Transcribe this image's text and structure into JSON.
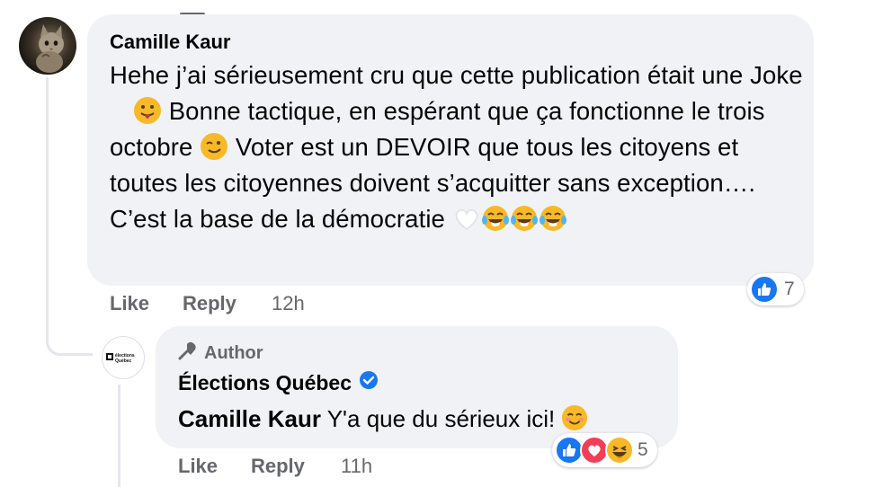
{
  "comment": {
    "author_name": "Camille Kaur",
    "text_parts": [
      "Hehe j’ai sérieusement cru que cette publication était une Joke ",
      " Bonne tactique, en espérant que ça fonctionne le trois octobre ",
      " Voter est un DEVOIR que tous les citoyens et toutes les citoyennes doivent s’acquitter sans exception…. C’est la base de la démocratie "
    ],
    "actions": {
      "like": "Like",
      "reply": "Reply",
      "time": "12h"
    },
    "reactions": {
      "count": "7",
      "icons": [
        "like-icon"
      ]
    }
  },
  "reply": {
    "badge": "Author",
    "page_name": "Élections Québec",
    "mention": "Camille Kaur",
    "text": " Y'a que du sérieux ici! ",
    "actions": {
      "like": "Like",
      "reply": "Reply",
      "time": "11h"
    },
    "reactions": {
      "count": "5",
      "icons": [
        "like-icon",
        "love-icon",
        "haha-icon"
      ]
    }
  },
  "colors": {
    "bubble": "#f0f2f5",
    "meta": "#65676b",
    "like_blue": "#1877f2",
    "love_red": "#f33e58",
    "emoji_yellow": "#f7b928"
  }
}
